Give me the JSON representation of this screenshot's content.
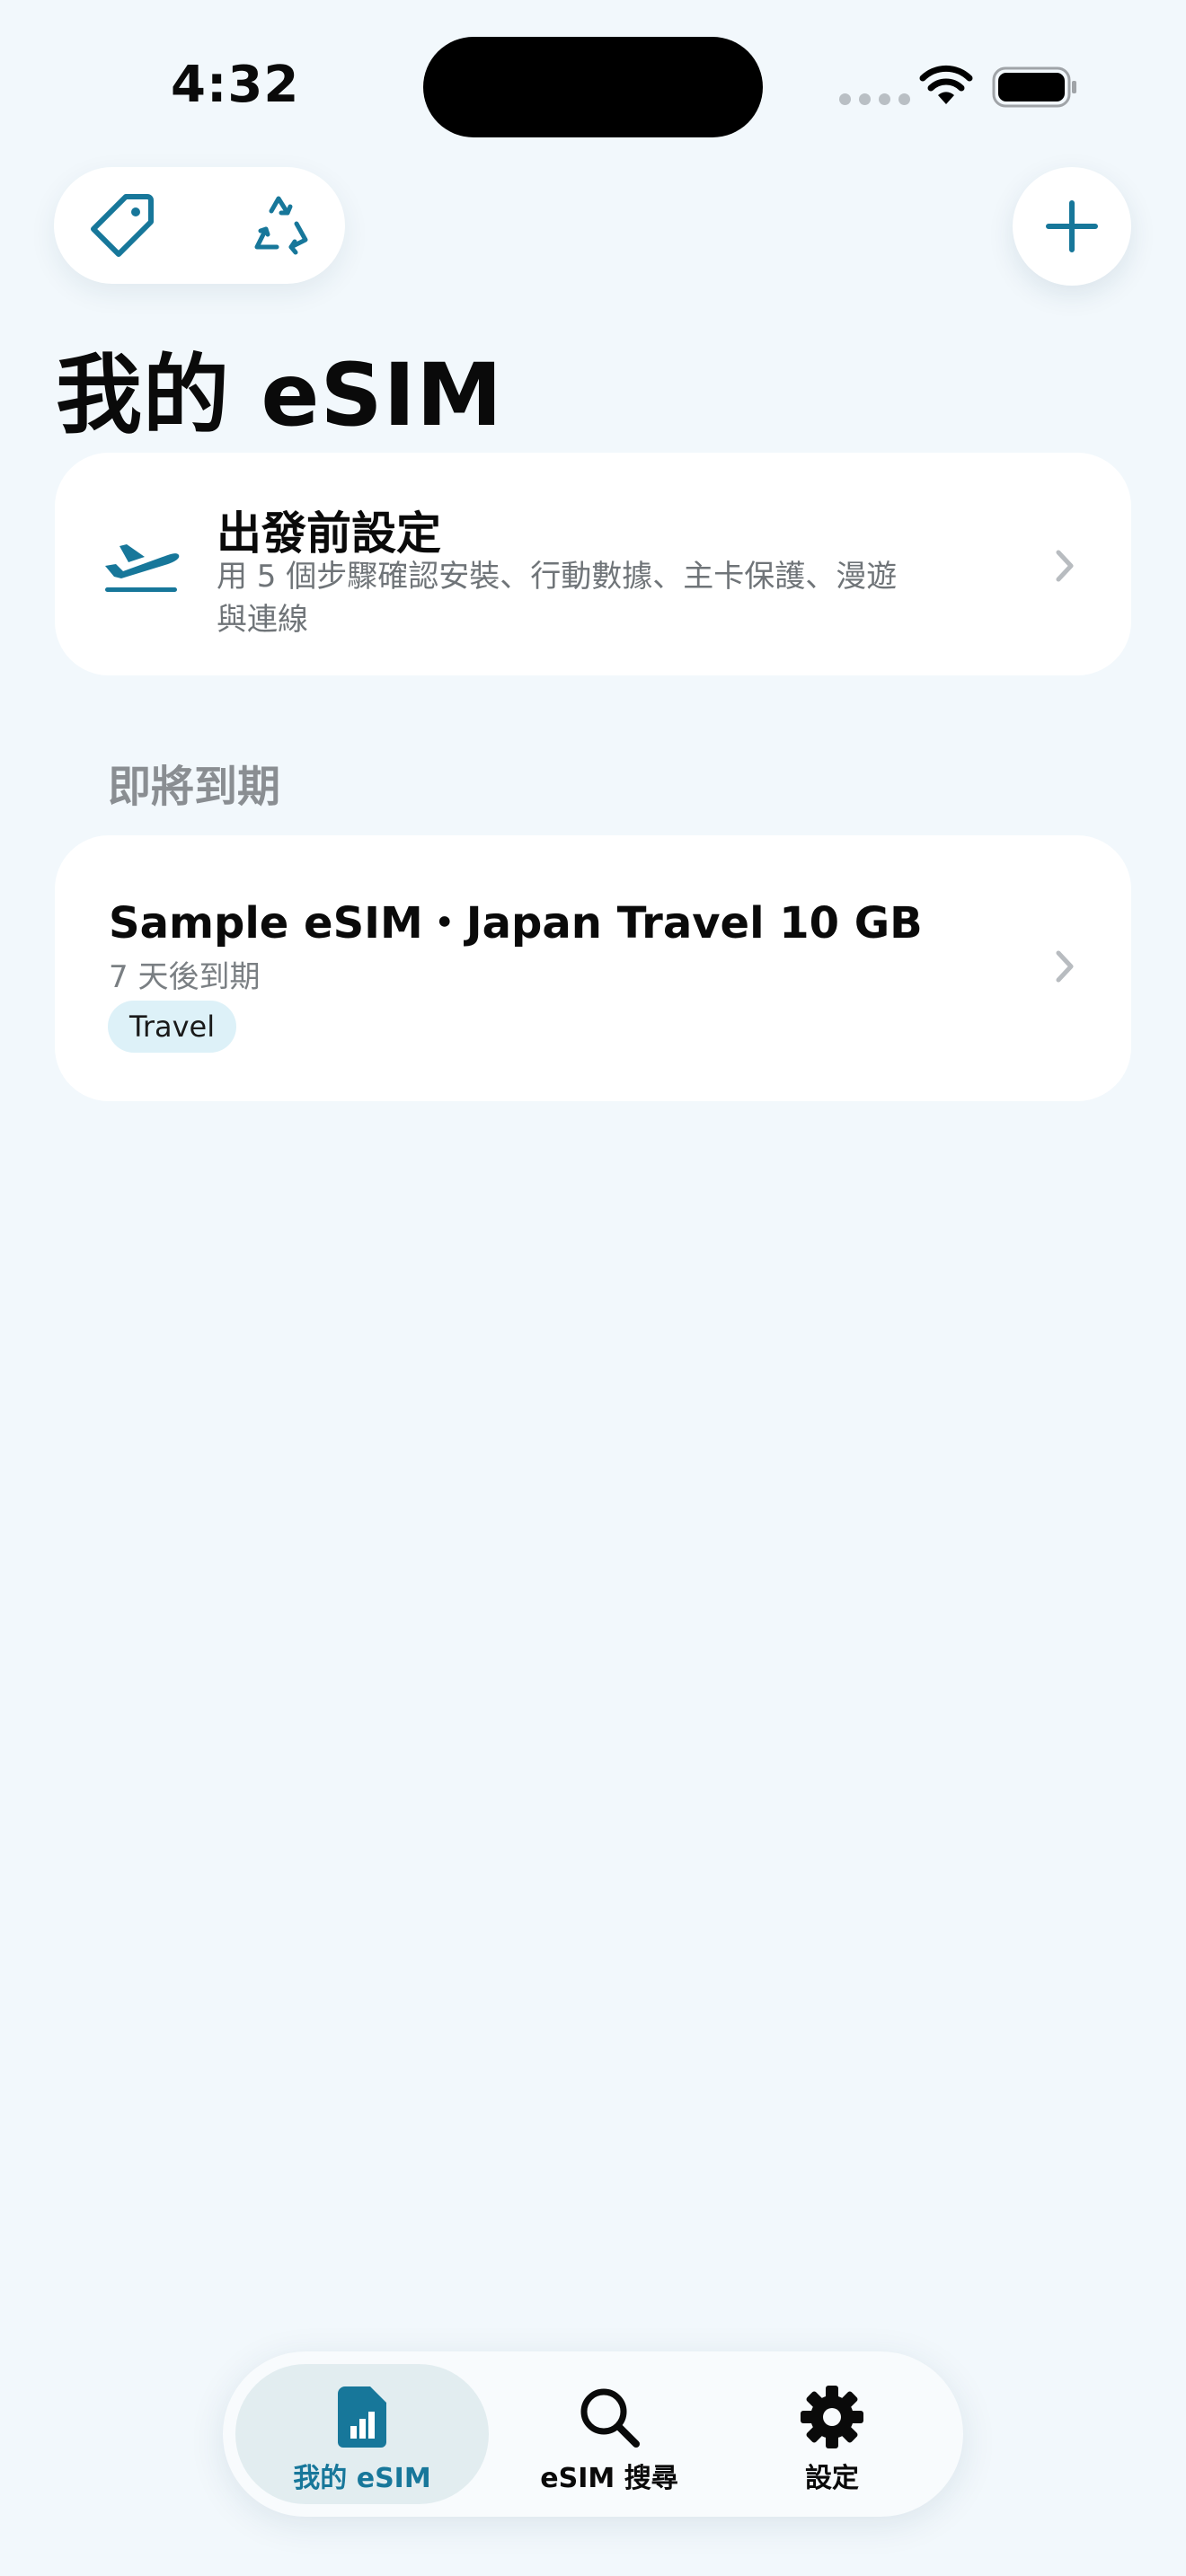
{
  "status_bar": {
    "time": "4:32"
  },
  "page": {
    "title": "我的 eSIM"
  },
  "setup_card": {
    "title": "出發前設定",
    "subtitle": "用 5 個步驟確認安裝、行動數據、主卡保護、漫遊與連線"
  },
  "section": {
    "expiring_header": "即將到期"
  },
  "esim_card": {
    "name": "Sample eSIM・Japan Travel 10 GB",
    "expiry": "7 天後到期",
    "tag": "Travel"
  },
  "tab_bar": {
    "tabs": [
      {
        "label": "我的 eSIM",
        "icon": "sim-card-icon",
        "active": true
      },
      {
        "label": "eSIM 搜尋",
        "icon": "search-icon",
        "active": false
      },
      {
        "label": "設定",
        "icon": "gear-icon",
        "active": false
      }
    ]
  },
  "colors": {
    "background": "#F2F8FC",
    "accent": "#17779A",
    "card": "#FFFFFF",
    "tag_background": "#DDF1F8"
  }
}
